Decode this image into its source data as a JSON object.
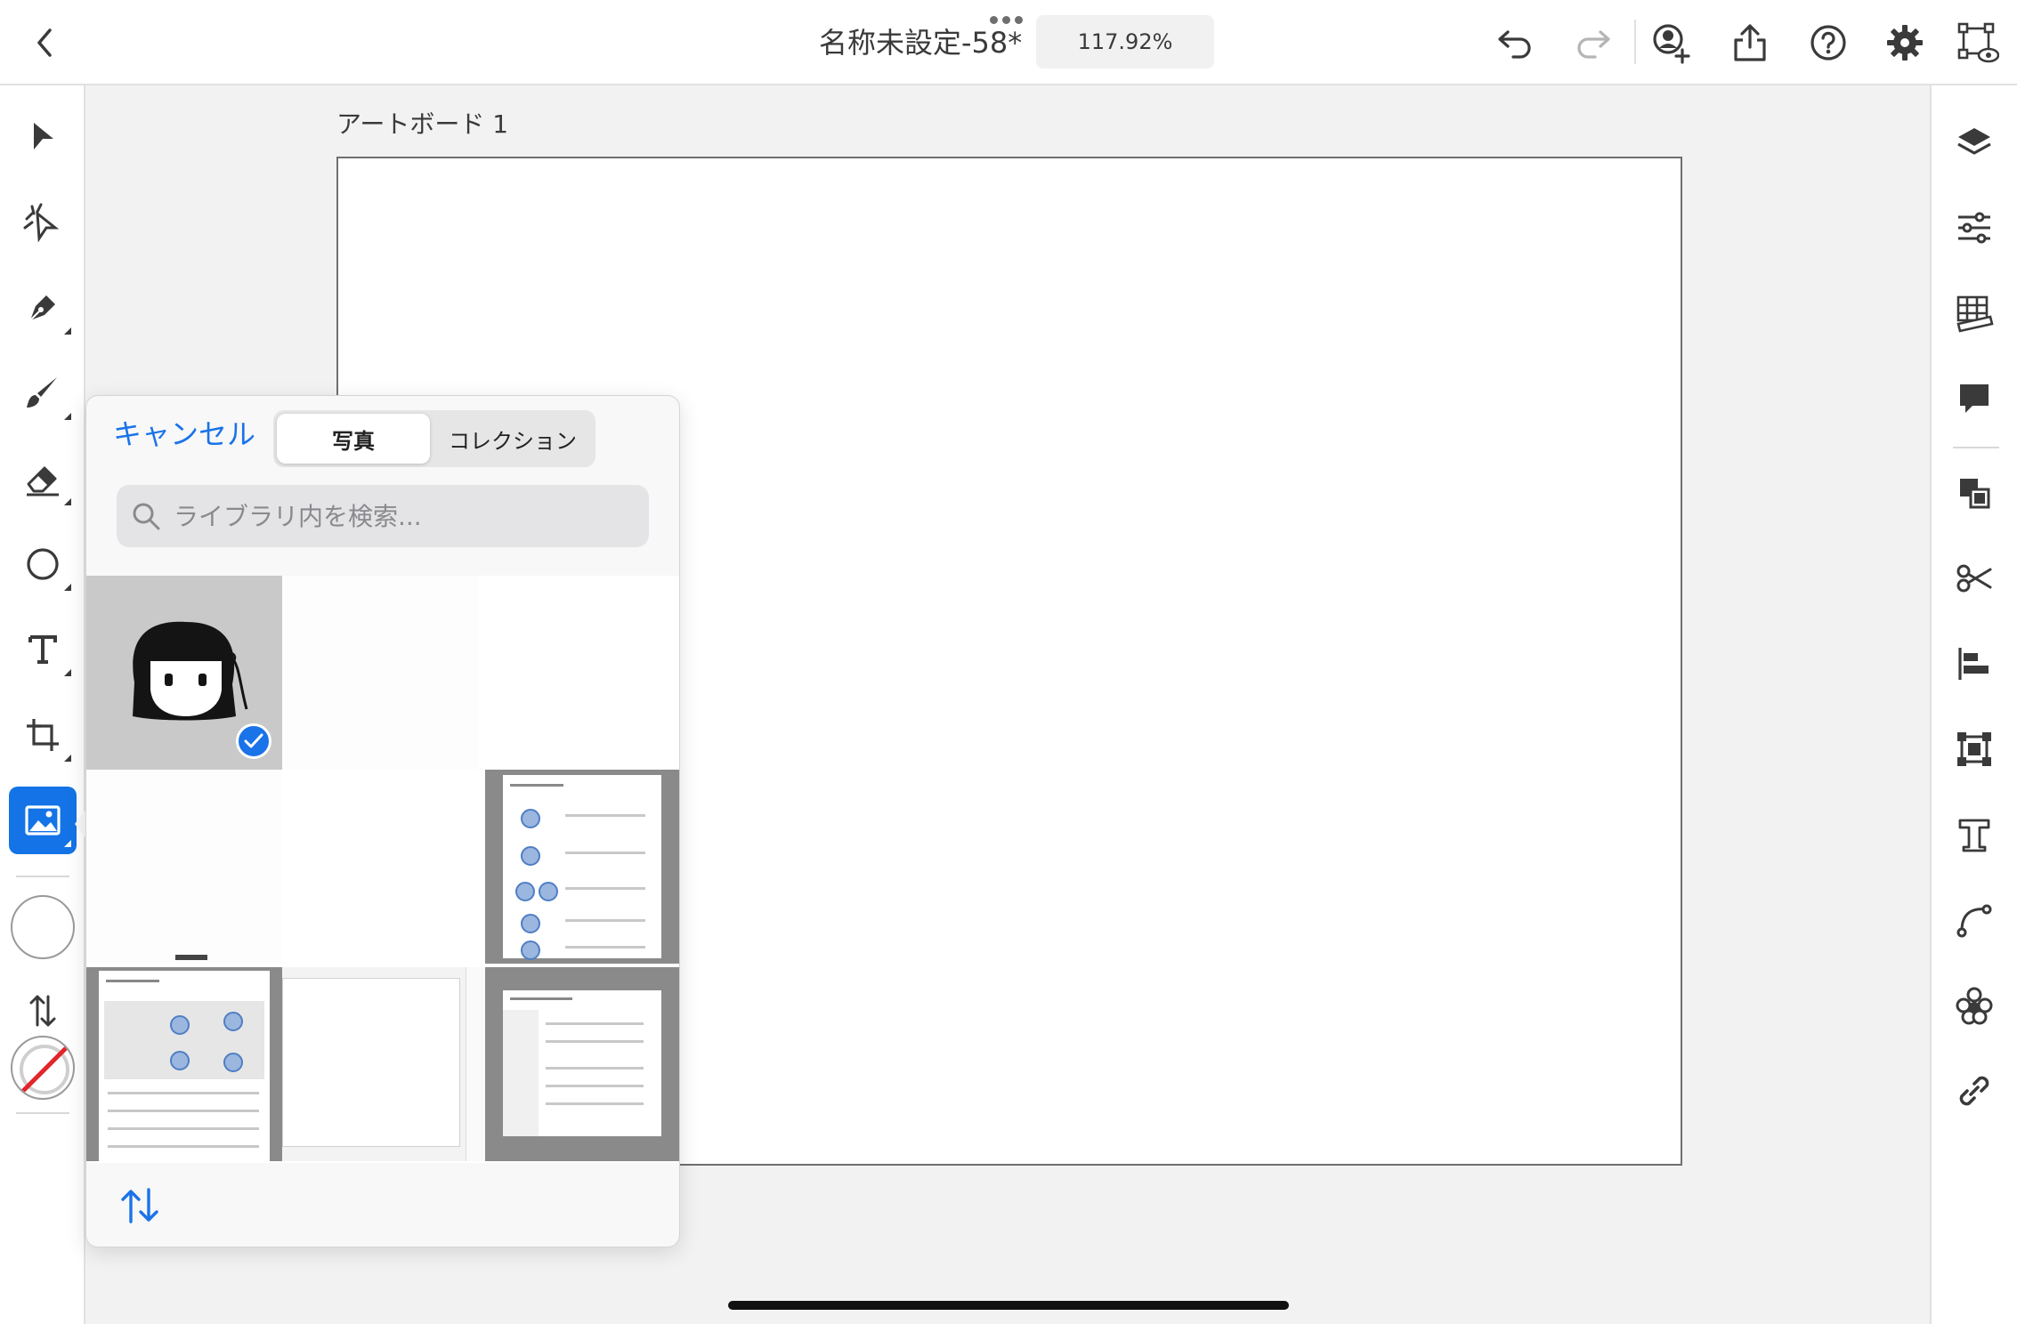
{
  "topbar": {
    "document_title": "名称未設定-58*",
    "zoom": "117.92%"
  },
  "canvas": {
    "artboard_label": "アートボード 1"
  },
  "picker": {
    "cancel_label": "キャンセル",
    "tabs": [
      {
        "label": "写真",
        "selected": true
      },
      {
        "label": "コレクション",
        "selected": false
      }
    ],
    "search_placeholder": "ライブラリ内を検索..."
  },
  "colors": {
    "accent": "#1473e6",
    "link": "#1a73e8",
    "stroke_none": "#e0262a"
  },
  "icons": {
    "left_tools": [
      "select-arrow-icon",
      "direct-select-icon",
      "pen-icon",
      "brush-icon",
      "eraser-icon",
      "ellipse-icon",
      "text-icon",
      "crop-icon",
      "image-icon"
    ],
    "right_tools": [
      "layers-icon",
      "properties-icon",
      "grid-ruler-icon",
      "comment-icon",
      "arrange-icon",
      "scissors-icon",
      "align-icon",
      "transform-icon",
      "type-icon",
      "path-icon",
      "repeat-icon",
      "link-icon"
    ],
    "top_tools": [
      "undo-icon",
      "redo-icon",
      "invite-user-icon",
      "share-icon",
      "help-icon",
      "settings-icon",
      "preview-icon"
    ]
  }
}
